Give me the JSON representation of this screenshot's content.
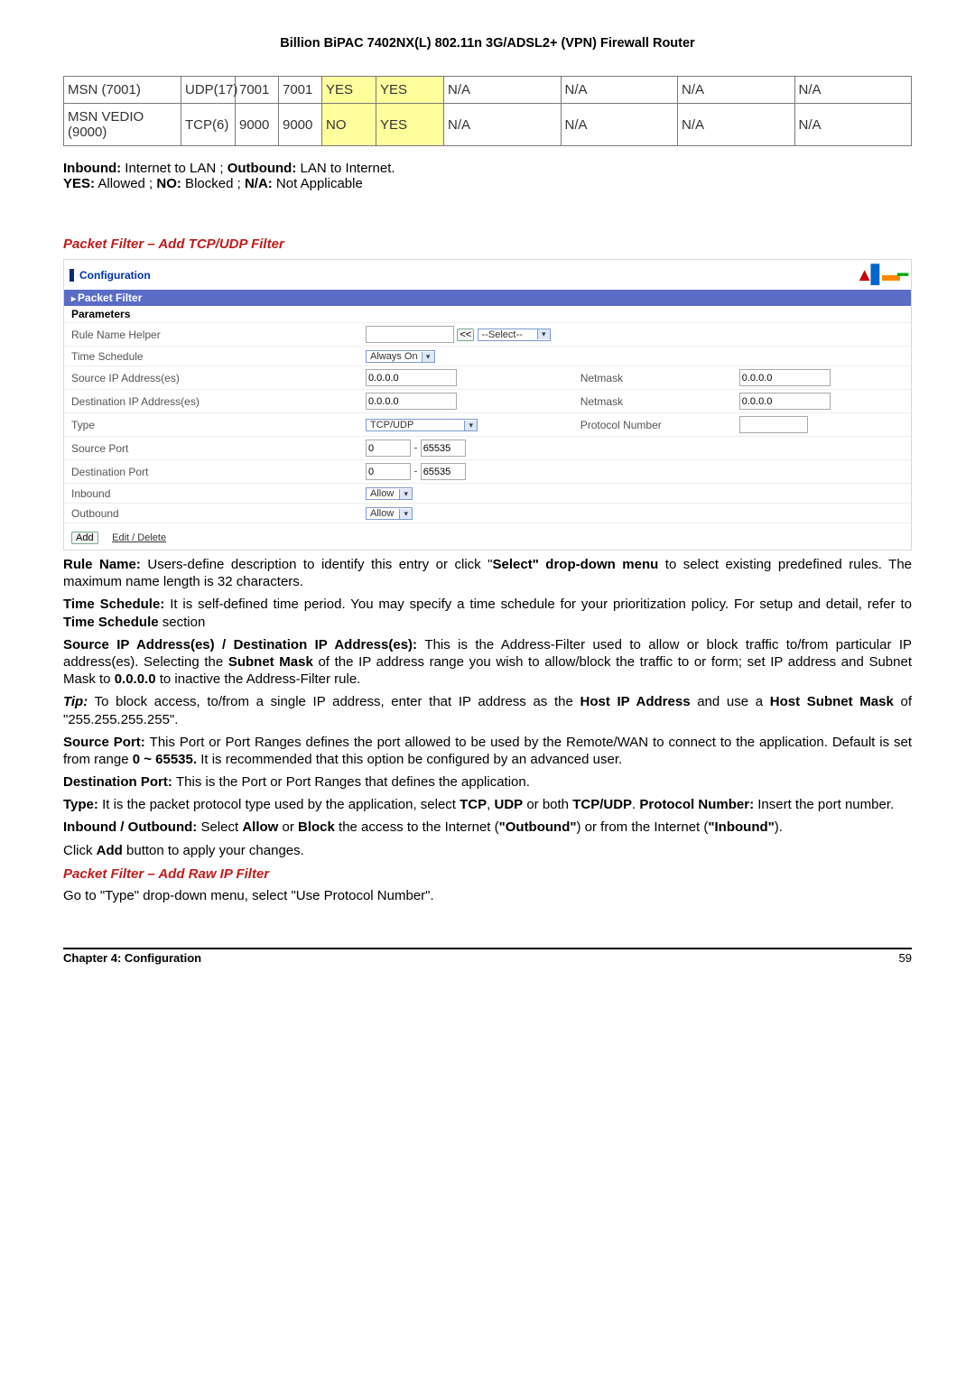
{
  "header": {
    "title": "Billion BiPAC 7402NX(L) 802.11n 3G/ADSL2+ (VPN) Firewall Router"
  },
  "table": {
    "rows": [
      {
        "name": "MSN (7001)",
        "proto": "UDP(17)",
        "p1": "7001",
        "p2": "7001",
        "c1": "YES",
        "c2": "YES",
        "c3": "N/A",
        "c4": "N/A",
        "c5": "N/A",
        "c6": "N/A"
      },
      {
        "name": "MSN VEDIO (9000)",
        "proto": "TCP(6)",
        "p1": "9000",
        "p2": "9000",
        "c1": "NO",
        "c2": "YES",
        "c3": "N/A",
        "c4": "N/A",
        "c5": "N/A",
        "c6": "N/A"
      }
    ]
  },
  "notes": {
    "line1a": "Inbound:",
    "line1b": " Internet to LAN ; ",
    "line1c": "Outbound:",
    "line1d": " LAN to Internet.",
    "line2a": "YES:",
    "line2b": " Allowed ; ",
    "line2c": "NO:",
    "line2d": " Blocked ; ",
    "line2e": "N/A:",
    "line2f": " Not Applicable"
  },
  "section1": "Packet Filter – Add TCP/UDP Filter",
  "panel": {
    "conf": "Configuration",
    "sub": "Packet Filter",
    "params": "Parameters",
    "ruleName": "Rule Name  Helper",
    "helperBtn": "<<",
    "helperSel": "--Select--",
    "timeSchedule": "Time Schedule",
    "timeSel": "Always On",
    "srcIp": "Source IP Address(es)",
    "srcIpVal": "0.0.0.0",
    "netmask": "Netmask",
    "srcMask": "0.0.0.0",
    "dstIp": "Destination IP Address(es)",
    "dstIpVal": "0.0.0.0",
    "dstMask": "0.0.0.0",
    "type": "Type",
    "typeSel": "TCP/UDP",
    "protoNum": "Protocol Number",
    "srcPort": "Source Port",
    "sp1": "0",
    "sp2": "65535",
    "dstPort": "Destination Port",
    "dp1": "0",
    "dp2": "65535",
    "inbound": "Inbound",
    "inSel": "Allow",
    "outbound": "Outbound",
    "outSel": "Allow",
    "add": "Add",
    "edit": "Edit / Delete"
  },
  "descr": {
    "ruleName1": "Rule Name: ",
    "ruleName2": "Users-define description to identify this entry or click \"",
    "ruleName3": "Select\" drop-down menu",
    "ruleName4": " to select existing predefined rules. The maximum name length is 32 characters.",
    "time1": "Time Schedule: ",
    "time2": "It is self-defined time period.   You may specify a time schedule for your prioritization policy. For setup and detail, refer to ",
    "time3": "Time Schedule",
    "time4": " section",
    "addr1": "Source IP Address(es) / Destination IP Address(es): ",
    "addr2": "This is the Address-Filter used to allow or block traffic to/from particular IP address(es).    Selecting the ",
    "addr3": "Subnet Mask",
    "addr4": " of the IP address range you wish to allow/block the traffic to or form; set IP address and Subnet Mask to ",
    "addr5": "0.0.0.0",
    "addr6": " to inactive the Address-Filter rule.",
    "tip1": "Tip:",
    "tip2": " To block access, to/from a single IP address, enter that IP address as the ",
    "tip3": "Host IP Address",
    "tip4": " and use a ",
    "tip5": "Host Subnet Mask",
    "tip6": " of \"255.255.255.255\".",
    "sport1": "Source Port: ",
    "sport2": "This Port or Port Ranges defines the port allowed to be used by the Remote/WAN to connect to the application. Default is set from range ",
    "sport3": "0 ~ 65535.",
    "sport4": " It is recommended that this option be configured by an advanced user.",
    "dport1": "Destination Port: ",
    "dport2": "This is the Port or Port Ranges that defines the application.",
    "type1": "Type: ",
    "type2": "It is the packet protocol type used by the application, select ",
    "type3": "TCP",
    "type4": ", ",
    "type5": "UDP",
    "type6": " or both ",
    "type7": "TCP/UDP",
    "type8": ". ",
    "type9": "Protocol Number: ",
    "type10": "Insert the port number.",
    "io1": "Inbound / Outbound: ",
    "io2": "Select ",
    "io3": "Allow",
    "io4": " or ",
    "io5": "Block",
    "io6": " the access to the Internet (",
    "io7": "\"Outbound\"",
    "io8": ") or from the Internet (",
    "io9": "\"Inbound\"",
    "io10": ").",
    "click1": "Click ",
    "click2": "Add",
    "click3": " button to apply your changes."
  },
  "section2": "Packet Filter – Add Raw IP Filter",
  "raw": "Go to \"Type\" drop-down menu, select \"Use Protocol Number\".",
  "footer": {
    "chapter": "Chapter 4: Configuration",
    "page": "59"
  }
}
